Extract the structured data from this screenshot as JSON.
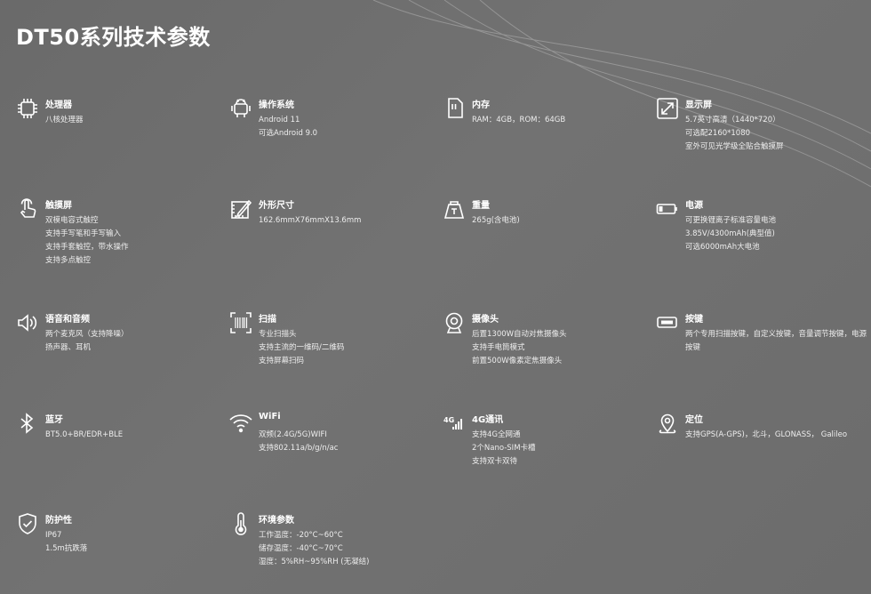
{
  "page": {
    "title": "DT50系列技术参数"
  },
  "specs": [
    {
      "name": "处理器",
      "lines": [
        "八核处理器"
      ]
    },
    {
      "name": "操作系统",
      "lines": [
        "Android 11",
        "可选Android 9.0"
      ]
    },
    {
      "name": "内存",
      "lines": [
        "RAM：4GB，ROM：64GB"
      ]
    },
    {
      "name": "显示屏",
      "lines": [
        "5.7英寸高清（1440*720）",
        "可选配2160*1080",
        "室外可见光学级全贴合触摸屏"
      ]
    },
    {
      "name": "触摸屏",
      "lines": [
        "双模电容式触控",
        "支持手写笔和手写输入",
        "支持手套触控，带水操作",
        "支持多点触控"
      ]
    },
    {
      "name": "外形尺寸",
      "lines": [
        "162.6mmX76mmX13.6mm"
      ]
    },
    {
      "name": "重量",
      "lines": [
        "265g(含电池)"
      ]
    },
    {
      "name": "电源",
      "lines": [
        "可更换锂离子标准容量电池",
        "3.85V/4300mAh(典型值)",
        "可选6000mAh大电池"
      ]
    },
    {
      "name": "语音和音频",
      "lines": [
        "两个麦克风（支持降噪）",
        "扬声器、耳机"
      ]
    },
    {
      "name": "扫描",
      "lines": [
        "专业扫描头",
        "支持主流的一维码/二维码",
        "支持屏幕扫码"
      ]
    },
    {
      "name": "摄像头",
      "lines": [
        "后置1300W自动对焦摄像头",
        "支持手电筒模式",
        "前置500W像素定焦摄像头"
      ]
    },
    {
      "name": "按键",
      "lines": [
        "两个专用扫描按键，自定义按键，音量调节按键，电源按键"
      ]
    },
    {
      "name": "蓝牙",
      "lines": [
        "BT5.0+BR/EDR+BLE"
      ]
    },
    {
      "name": "WiFi",
      "lines": [
        "双频(2.4G/5G)WIFI",
        "支持802.11a/b/g/n/ac"
      ]
    },
    {
      "name": "4G通讯",
      "lines": [
        "支持4G全网通",
        "2个Nano-SIM卡槽",
        "支持双卡双待"
      ]
    },
    {
      "name": "定位",
      "lines": [
        "支持GPS(A-GPS)，北斗，GLONASS， Galileo"
      ]
    },
    {
      "name": "防护性",
      "lines": [
        "IP67",
        "1.5m抗跌落"
      ]
    },
    {
      "name": "环境参数",
      "lines": [
        "工作温度：-20°C~60°C",
        "储存温度：-40°C~70°C",
        "湿度：5%RH~95%RH (无凝结)"
      ]
    }
  ],
  "icons": [
    "cpu-icon",
    "android-icon",
    "sd-card-icon",
    "expand-icon",
    "touch-icon",
    "ruler-icon",
    "weight-icon",
    "battery-icon",
    "speaker-icon",
    "barcode-icon",
    "camera-icon",
    "key-icon",
    "bluetooth-icon",
    "wifi-icon",
    "4g-signal-icon",
    "location-pin-icon",
    "shield-icon",
    "thermometer-icon"
  ],
  "icon_label_4g": "4G"
}
